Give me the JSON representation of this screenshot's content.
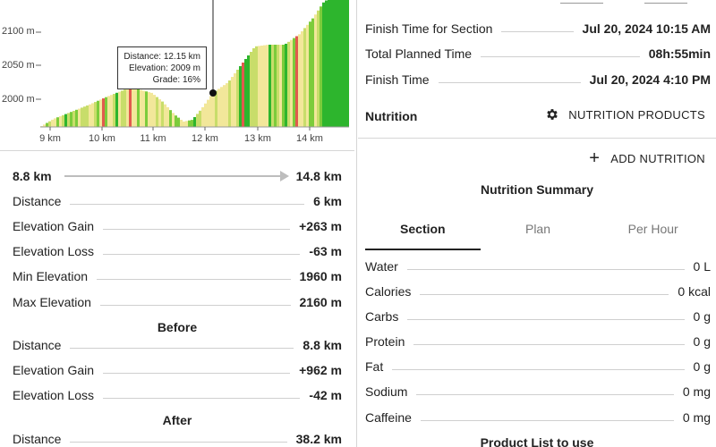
{
  "chart": {
    "y_ticks": [
      "2100 m",
      "2050 m",
      "2000 m"
    ],
    "x_ticks": [
      "9 km",
      "10 km",
      "11 km",
      "12 km",
      "13 km",
      "14 km"
    ],
    "tooltip": {
      "distance": "Distance: 12.15 km",
      "elevation": "Elevation: 2009 m",
      "grade": "Grade: 16%"
    },
    "colors": {
      "green_dark": "#2db52d",
      "green": "#7ccc3b",
      "yellow_green": "#c8dd6a",
      "yellow": "#f2e79a",
      "red": "#e15a4e"
    }
  },
  "section": {
    "start": "8.8 km",
    "end": "14.8 km",
    "rows": [
      {
        "label": "Distance",
        "value": "6 km"
      },
      {
        "label": "Elevation Gain",
        "value": "+263 m"
      },
      {
        "label": "Elevation Loss",
        "value": "-63 m"
      },
      {
        "label": "Min Elevation",
        "value": "1960 m"
      },
      {
        "label": "Max Elevation",
        "value": "2160 m"
      }
    ]
  },
  "before": {
    "title": "Before",
    "rows": [
      {
        "label": "Distance",
        "value": "8.8 km"
      },
      {
        "label": "Elevation Gain",
        "value": "+962 m"
      },
      {
        "label": "Elevation Loss",
        "value": "-42 m"
      }
    ]
  },
  "after": {
    "title": "After",
    "rows": [
      {
        "label": "Distance",
        "value": "38.2 km"
      }
    ]
  },
  "timing": {
    "rows": [
      {
        "label": "Finish Time for Section",
        "value": "Jul 20, 2024 10:15 AM"
      },
      {
        "label": "Total Planned Time",
        "value": "08h:55min"
      },
      {
        "label": "Finish Time",
        "value": "Jul 20, 2024 4:10 PM"
      }
    ]
  },
  "nutrition": {
    "heading": "Nutrition",
    "products_button": "NUTRITION PRODUCTS",
    "gear_icon": "gear-icon",
    "add_button": "ADD NUTRITION",
    "summary_title": "Nutrition Summary",
    "tabs": [
      "Section",
      "Plan",
      "Per Hour"
    ],
    "active_tab": "Section",
    "rows": [
      {
        "label": "Water",
        "value": "0 L"
      },
      {
        "label": "Calories",
        "value": "0 kcal"
      },
      {
        "label": "Carbs",
        "value": "0 g"
      },
      {
        "label": "Protein",
        "value": "0 g"
      },
      {
        "label": "Fat",
        "value": "0 g"
      },
      {
        "label": "Sodium",
        "value": "0 mg"
      },
      {
        "label": "Caffeine",
        "value": "0 mg"
      }
    ],
    "product_list_title": "Product List to use"
  }
}
